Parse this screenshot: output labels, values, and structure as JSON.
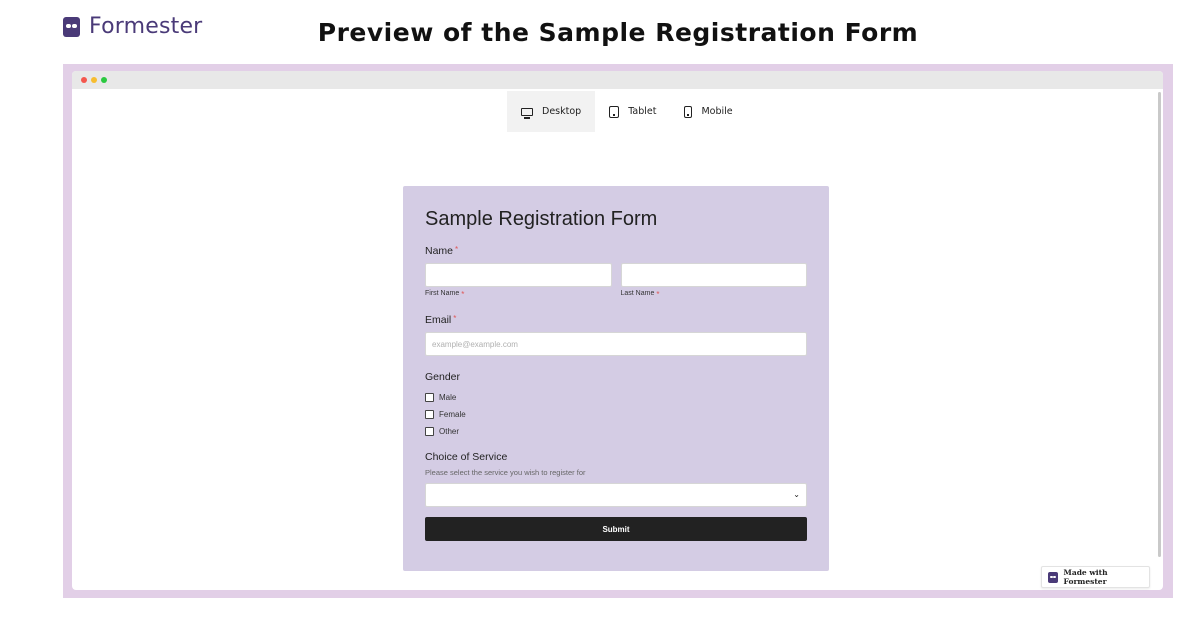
{
  "brand": {
    "name": "Formester"
  },
  "headline": "Preview of the Sample Registration Form",
  "device_tabs": [
    {
      "label": "Desktop",
      "active": true
    },
    {
      "label": "Tablet",
      "active": false
    },
    {
      "label": "Mobile",
      "active": false
    }
  ],
  "form": {
    "title": "Sample Registration Form",
    "name": {
      "label": "Name",
      "required_mark": "*",
      "first_sub": "First Name",
      "last_sub": "Last Name"
    },
    "email": {
      "label": "Email",
      "required_mark": "*",
      "placeholder": "example@example.com"
    },
    "gender": {
      "label": "Gender",
      "options": [
        "Male",
        "Female",
        "Other"
      ]
    },
    "service": {
      "label": "Choice of Service",
      "help": "Please select the service you wish to register for"
    },
    "submit_label": "Submit"
  },
  "badge": {
    "text": "Made with Formester"
  },
  "colors": {
    "brand": "#4a3a78",
    "form_bg": "#d4cce4",
    "frame_bg": "#e2cfe7",
    "submit_bg": "#222222",
    "required": "#e05757"
  }
}
